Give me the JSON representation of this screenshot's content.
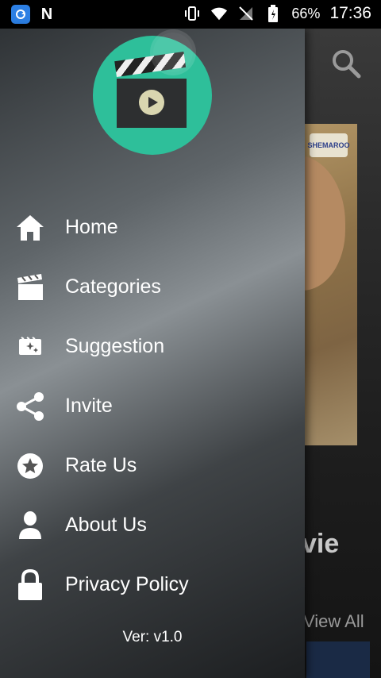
{
  "status": {
    "battery": "66%",
    "time": "17:36"
  },
  "background": {
    "section_title_fragment": "vie",
    "view_all": "View All",
    "poster_logo_text": "SHEMAROO"
  },
  "drawer": {
    "menu": [
      {
        "label": "Home",
        "icon": "home-icon"
      },
      {
        "label": "Categories",
        "icon": "clapperboard-icon"
      },
      {
        "label": "Suggestion",
        "icon": "sparkle-film-icon"
      },
      {
        "label": "Invite",
        "icon": "share-icon"
      },
      {
        "label": "Rate Us",
        "icon": "star-icon"
      },
      {
        "label": "About Us",
        "icon": "person-icon"
      },
      {
        "label": "Privacy Policy",
        "icon": "lock-icon"
      }
    ],
    "version": "Ver: v1.0"
  },
  "colors": {
    "logo_circle": "#2ebf9a",
    "status_bar": "#000000"
  }
}
